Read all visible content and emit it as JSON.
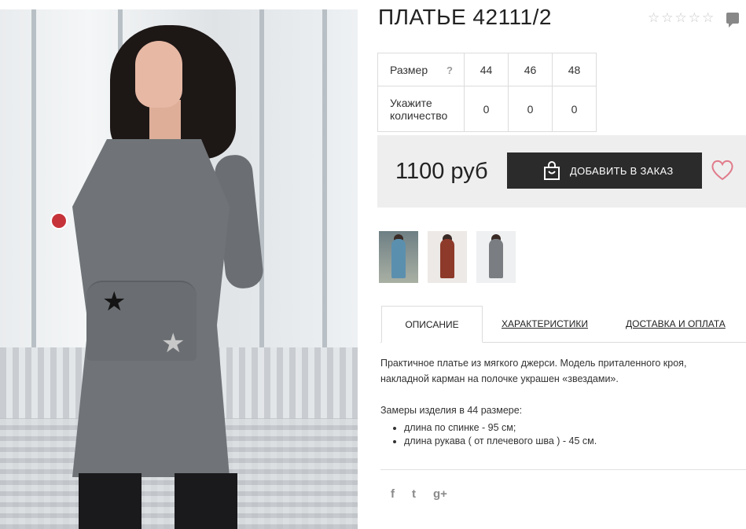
{
  "product": {
    "title": "ПЛАТЬЕ 42111/2",
    "rating_stars": 5,
    "rating_filled": 0
  },
  "sizes": {
    "size_label": "Размер",
    "help_mark": "?",
    "qty_label_line1": "Укажите",
    "qty_label_line2": "количество",
    "sizes": [
      "44",
      "46",
      "48"
    ],
    "quantities": [
      "0",
      "0",
      "0"
    ]
  },
  "purchase": {
    "price": "1100 руб",
    "add_button": "ДОБАВИТЬ В ЗАКАЗ"
  },
  "tabs": {
    "description": "ОПИСАНИЕ",
    "characteristics": "ХАРАКТЕРИСТИКИ",
    "delivery": "ДОСТАВКА И ОПЛАТА"
  },
  "description": {
    "text": "Практичное платье из мягкого джерси. Модель приталенного кроя, накладной карман на полочке украшен «звездами».",
    "measurements_title": "Замеры изделия в 44 размере:",
    "measurements": [
      "длина по спинке - 95 см;",
      "длина рукава ( от плечевого шва ) - 45 см."
    ]
  },
  "social": {
    "facebook": "f",
    "twitter": "t",
    "google": "g+"
  },
  "colors": {
    "dark_button": "#2b2b2b",
    "price_bg": "#eeeeee",
    "heart": "#e07a8a",
    "thumb_colors": [
      "#5b8fae",
      "#8e3a2a",
      "#7a7e82"
    ]
  }
}
